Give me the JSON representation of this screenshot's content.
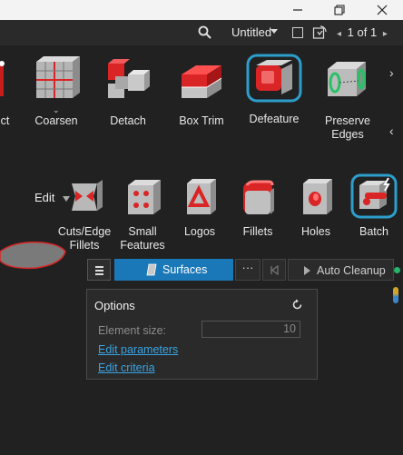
{
  "window": {
    "icons": [
      "minimize-icon",
      "maximize-icon",
      "close-icon"
    ]
  },
  "topbar": {
    "document_title": "Untitled",
    "pager_text": "1 of 1"
  },
  "ribbon": {
    "row1": [
      {
        "label": "ect"
      },
      {
        "label": "Coarsen"
      },
      {
        "label": "Detach"
      },
      {
        "label": "Box Trim"
      },
      {
        "label": "Defeature"
      },
      {
        "label_line1": "Preserve",
        "label_line2": "Edges"
      }
    ],
    "group_label": "Edit",
    "row2": [
      {
        "label_line1": "Cuts/Edge",
        "label_line2": "Fillets"
      },
      {
        "label_line1": "Small",
        "label_line2": "Features"
      },
      {
        "label": "Logos"
      },
      {
        "label": "Fillets"
      },
      {
        "label": "Holes"
      },
      {
        "label": "Batch"
      }
    ]
  },
  "panel": {
    "active_tab": "Surfaces",
    "more_label": "···",
    "run_label": "Auto Cleanup"
  },
  "options": {
    "title": "Options",
    "element_size_label": "Element size:",
    "element_size_value": "10",
    "edit_parameters": "Edit parameters",
    "edit_criteria": "Edit criteria"
  },
  "colors": {
    "accent_blue": "#1a78b8",
    "link_blue": "#3aa3e3",
    "selection_glow": "#2fb4ea",
    "tool_red": "#d92525"
  }
}
